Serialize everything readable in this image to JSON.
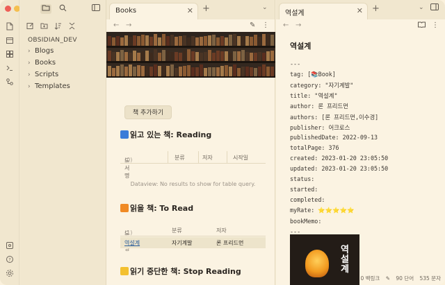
{
  "window": {
    "traffic_lights": [
      "#ee5f57",
      "#f5bf4f",
      "#5fc45b"
    ]
  },
  "ribbon": {
    "icons": [
      "files-icon",
      "calendar-icon",
      "graph-icon",
      "terminal-icon",
      "template-icon"
    ],
    "bottom_icons": [
      "vault-icon",
      "help-icon",
      "settings-icon"
    ]
  },
  "sidebar": {
    "vault_name": "OBSIDIAN_DEV",
    "folders": [
      {
        "label": "Blogs"
      },
      {
        "label": "Books"
      },
      {
        "label": "Scripts"
      },
      {
        "label": "Templates"
      }
    ]
  },
  "left_pane": {
    "tab_title": "Books",
    "add_button": "책 추가하기",
    "sections": [
      {
        "heading": "읽고 있는 책: Reading",
        "color": "#3b7dd8",
        "columns": [
          "도서명",
          "분류",
          "저자",
          "시작일"
        ],
        "count": "(0)",
        "empty_message": "Dataview: No results to show for table query."
      },
      {
        "heading": "읽을 책: To Read",
        "color": "#f08a24",
        "columns": [
          "도서명",
          "분류",
          "저자"
        ],
        "count": "(1)",
        "rows": [
          {
            "title": "역설계",
            "category": "자기계발",
            "author": "론 프리드먼"
          }
        ]
      },
      {
        "heading": "읽기 중단한 책: Stop Reading",
        "color": "#f3c02f"
      }
    ]
  },
  "right_pane": {
    "tab_title": "역설계",
    "doc_title": "역설계",
    "frontmatter": [
      "---",
      "tag: [📚Book]",
      "category: \"자기계발\"",
      "title: \"역설계\"",
      "author: 론 프리드먼",
      "authors: [론 프리드먼,이수경]",
      "publisher: 어크로스",
      "publishedDate: 2022-09-13",
      "totalPage: 376",
      "created: 2023-01-20 23:05:50",
      "updated: 2023-01-20 23:05:50",
      "status:",
      "started:",
      "completed:",
      "myRate: ⭐⭐⭐⭐⭐",
      "bookMemo:",
      "---"
    ],
    "cover_title": "역설계",
    "status": {
      "backlinks": "0 백링크",
      "words": "90 단어",
      "chars": "535 문자"
    }
  }
}
